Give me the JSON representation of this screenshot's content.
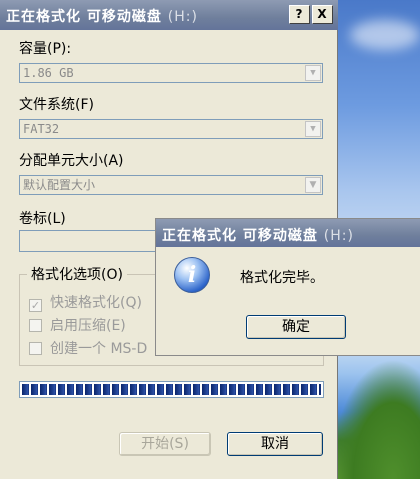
{
  "format_dialog": {
    "title": "正在格式化 可移动磁盘",
    "title_suffix": "(H:)",
    "help_button": "?",
    "close_button": "X",
    "capacity": {
      "label": "容量(P):",
      "value": "1.86 GB"
    },
    "file_system": {
      "label": "文件系统(F)",
      "value": "FAT32"
    },
    "allocation_unit": {
      "label": "分配单元大小(A)",
      "value": "默认配置大小"
    },
    "volume_label": {
      "label": "卷标(L)",
      "value": ""
    },
    "format_options": {
      "title": "格式化选项(O)",
      "items": [
        {
          "label": "快速格式化(Q)",
          "checked": true
        },
        {
          "label": "启用压缩(E)",
          "checked": false
        },
        {
          "label": "创建一个 MS-D",
          "checked": false
        }
      ]
    },
    "progress": 1.0,
    "start_button": "开始(S)",
    "cancel_button": "取消"
  },
  "message_box": {
    "title": "正在格式化 可移动磁盘",
    "title_suffix": "(H:)",
    "icon": "info-icon",
    "icon_glyph": "i",
    "message": "格式化完毕。",
    "ok_button": "确定"
  },
  "colors": {
    "title_bar": "#6f7f9c",
    "progress_fill": "#0a246a",
    "dialog_bg": "#ece9d8"
  }
}
